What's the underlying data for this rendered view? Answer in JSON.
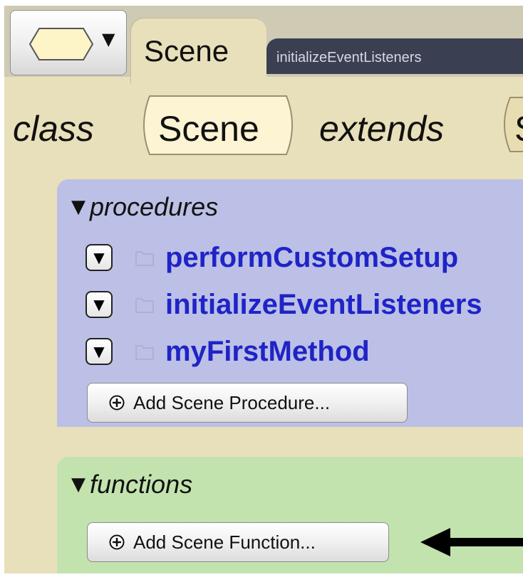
{
  "tabs": {
    "scene": "Scene",
    "method": "initializeEventListeners"
  },
  "class_header": {
    "class_keyword": "class",
    "class_name": "Scene",
    "extends_keyword": "extends",
    "superclass": "SThing"
  },
  "procedures": {
    "title": "procedures",
    "items": [
      {
        "name": "performCustomSetup"
      },
      {
        "name": "initializeEventListeners"
      },
      {
        "name": "myFirstMethod"
      }
    ],
    "add_label": "Add Scene Procedure..."
  },
  "functions": {
    "title": "functions",
    "add_label": "Add Scene Function..."
  },
  "colors": {
    "editor_bg": "#e8e0bb",
    "procedures_bg": "#bcc0e6",
    "functions_bg": "#c3e3ae",
    "procedure_name": "#1f24c7",
    "method_tab_bg": "#3b3f52"
  }
}
